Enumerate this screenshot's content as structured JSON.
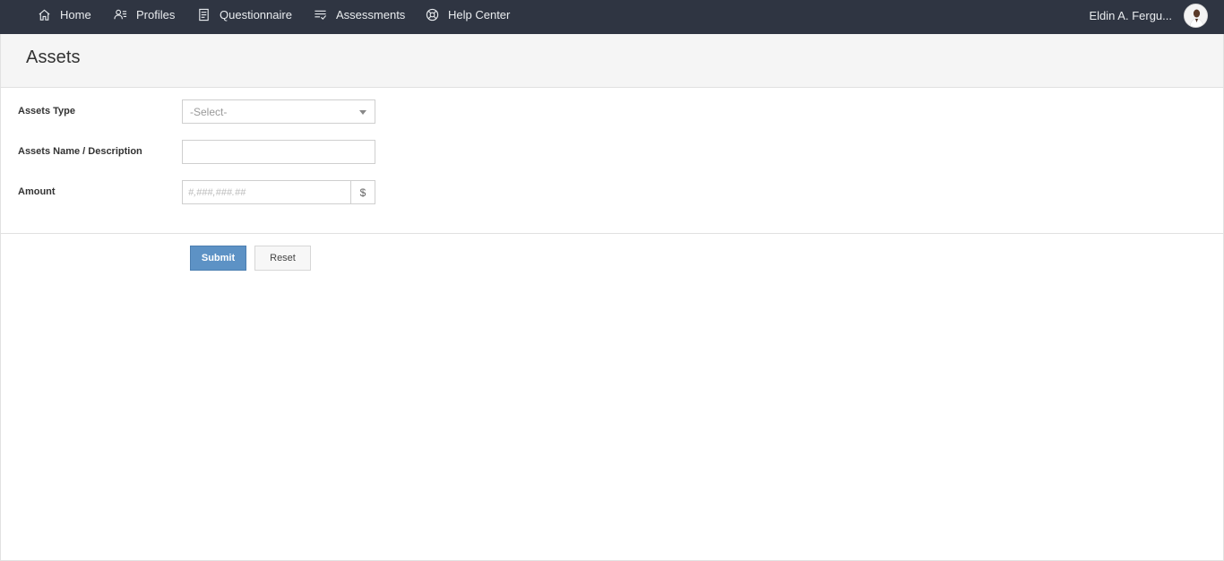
{
  "nav": {
    "items": [
      {
        "label": "Home",
        "icon": "home-icon"
      },
      {
        "label": "Profiles",
        "icon": "profiles-icon"
      },
      {
        "label": "Questionnaire",
        "icon": "questionnaire-icon"
      },
      {
        "label": "Assessments",
        "icon": "assessments-icon"
      },
      {
        "label": "Help Center",
        "icon": "help-center-icon"
      }
    ],
    "user_name": "Eldin A. Fergu..."
  },
  "page": {
    "title": "Assets"
  },
  "form": {
    "assets_type_label": "Assets Type",
    "assets_type_value": "-Select-",
    "name_label": "Assets Name / Description",
    "name_value": "",
    "amount_label": "Amount",
    "amount_placeholder": "#,###,###.##",
    "currency_symbol": "$"
  },
  "actions": {
    "submit_label": "Submit",
    "reset_label": "Reset"
  },
  "colors": {
    "topbar": "#2f3542",
    "primary_button": "#5d92c5"
  }
}
